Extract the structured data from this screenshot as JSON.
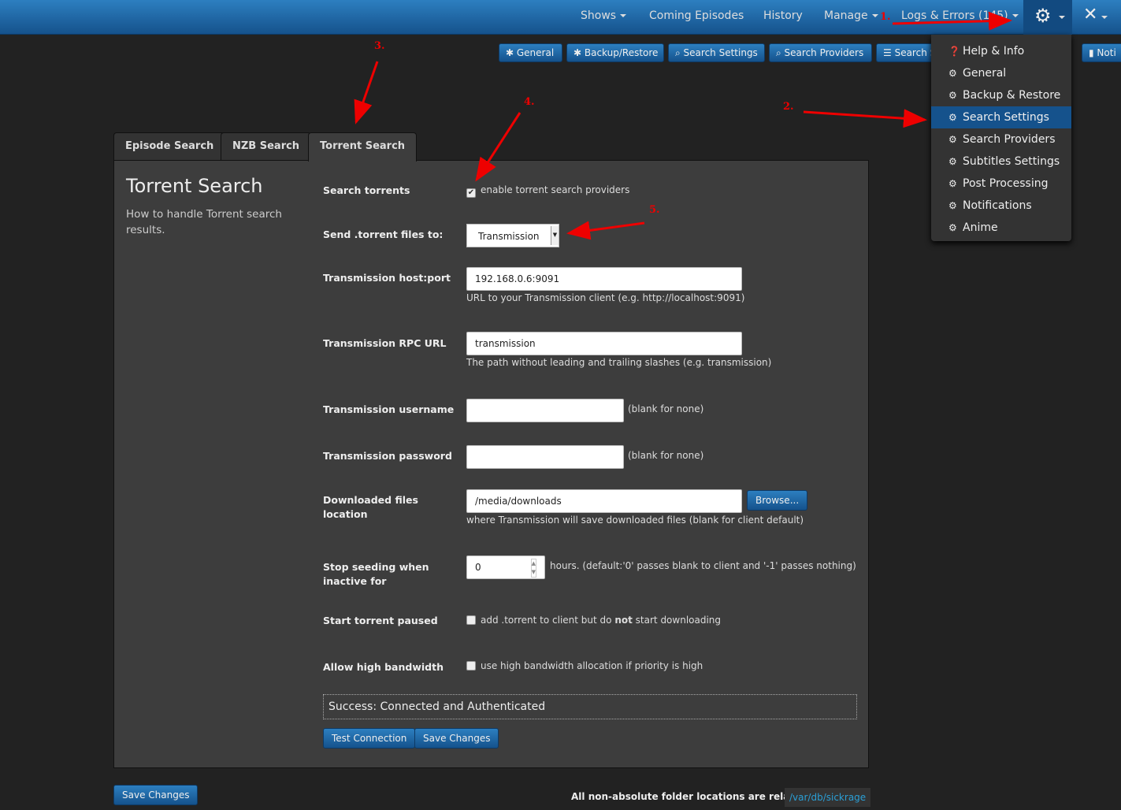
{
  "nav": {
    "items": [
      {
        "label": "Shows",
        "caret": true
      },
      {
        "label": "Coming Episodes"
      },
      {
        "label": "History"
      },
      {
        "label": "Manage",
        "caret": true
      },
      {
        "label": "Logs & Errors (145)",
        "caret": true
      }
    ],
    "gear_icon": "gear-icon",
    "tools_icon": "tools-icon"
  },
  "subnav": [
    "General",
    "Backup/Restore",
    "Search Settings",
    "Search Providers",
    "Search S",
    "Noti"
  ],
  "menu": [
    {
      "label": "Help & Info",
      "icon": "question-icon"
    },
    {
      "label": "General"
    },
    {
      "label": "Backup & Restore"
    },
    {
      "label": "Search Settings",
      "active": true
    },
    {
      "label": "Search Providers"
    },
    {
      "label": "Subtitles Settings"
    },
    {
      "label": "Post Processing"
    },
    {
      "label": "Notifications"
    },
    {
      "label": "Anime"
    }
  ],
  "tabs": [
    "Episode Search",
    "NZB Search",
    "Torrent Search"
  ],
  "section": {
    "title": "Torrent Search",
    "desc": "How to handle Torrent search results."
  },
  "form": {
    "search_torrents": {
      "label": "Search torrents",
      "text": "enable torrent search providers",
      "checked": true
    },
    "send_to": {
      "label": "Send .torrent files to:",
      "value": "Transmission"
    },
    "host": {
      "label": "Transmission host:port",
      "value": "192.168.0.6:9091",
      "hint": "URL to your Transmission client (e.g. http://localhost:9091)"
    },
    "rpc": {
      "label": "Transmission RPC URL",
      "value": "transmission",
      "hint": "The path without leading and trailing slashes (e.g. transmission)"
    },
    "username": {
      "label": "Transmission username",
      "value": "",
      "hint": "(blank for none)"
    },
    "password": {
      "label": "Transmission password",
      "value": "",
      "hint": "(blank for none)"
    },
    "location": {
      "label": "Downloaded files location",
      "value": "/media/downloads",
      "browse": "Browse...",
      "hint": "where Transmission will save downloaded files (blank for client default)"
    },
    "seeding": {
      "label": "Stop seeding when inactive for",
      "value": "0",
      "hint": "hours. (default:'0' passes blank to client and '-1' passes nothing)"
    },
    "paused": {
      "label": "Start torrent paused",
      "text_pre": "add .torrent to client but do ",
      "text_bold": "not",
      "text_post": " start downloading",
      "checked": false
    },
    "bandwidth": {
      "label": "Allow high bandwidth",
      "text": "use high bandwidth allocation if priority is high",
      "checked": false
    },
    "status": "Success: Connected and Authenticated",
    "test_button": "Test Connection",
    "save_button": "Save Changes"
  },
  "footer": {
    "save_button": "Save Changes",
    "note": "All non-absolute folder locations are relative to",
    "path": "/var/db/sickrage"
  },
  "annotations": [
    "1.",
    "2.",
    "3.",
    "4.",
    "5."
  ],
  "colors": {
    "accent": "#15528c",
    "annotation": "#ee0000"
  }
}
